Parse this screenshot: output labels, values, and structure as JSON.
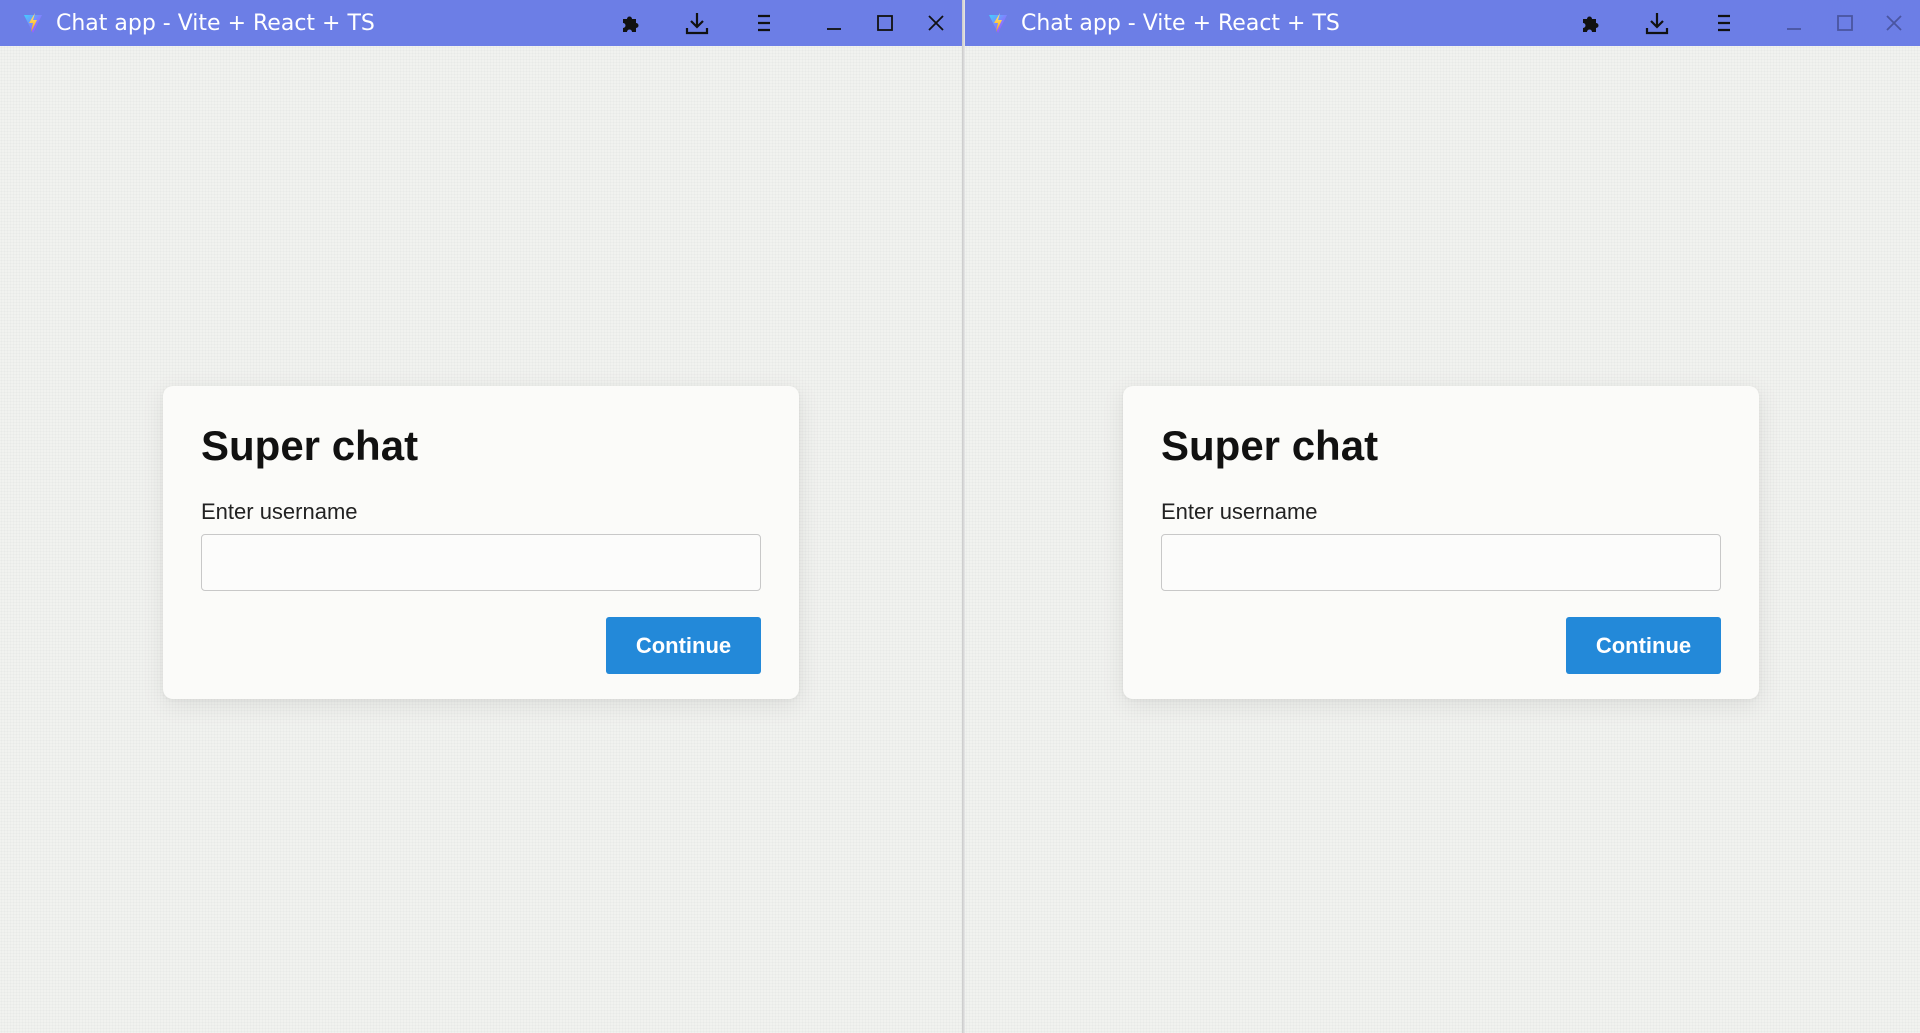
{
  "windows": [
    {
      "id": "left",
      "title": "Chat app - Vite + React + TS",
      "active": true,
      "card": {
        "title": "Super chat",
        "field_label": "Enter username",
        "username_value": "",
        "username_placeholder": "",
        "continue_label": "Continue"
      }
    },
    {
      "id": "right",
      "title": "Chat app - Vite + React + TS",
      "active": false,
      "card": {
        "title": "Super chat",
        "field_label": "Enter username",
        "username_value": "",
        "username_placeholder": "",
        "continue_label": "Continue"
      }
    }
  ],
  "icons": {
    "favicon": "vite-icon",
    "extensions": "puzzle-icon",
    "downloads": "download-icon",
    "menu": "hamburger-icon",
    "minimize": "minimize-icon",
    "maximize": "maximize-icon",
    "close": "close-icon"
  },
  "colors": {
    "titlebar": "#6c7ee6",
    "page_background": "#f1f2ef",
    "card_background": "#fbfbf9",
    "button": "#2389d9",
    "button_text": "#ffffff"
  }
}
